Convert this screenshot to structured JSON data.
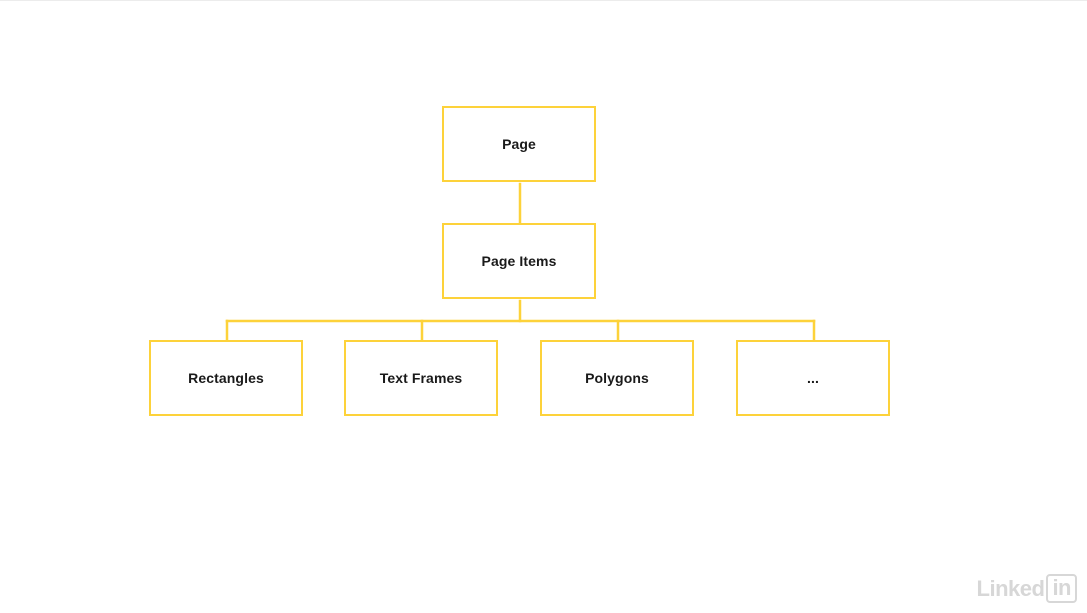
{
  "diagram": {
    "nodes": {
      "page": "Page",
      "page_items": "Page Items",
      "rectangles": "Rectangles",
      "text_frames": "Text Frames",
      "polygons": "Polygons",
      "more": "..."
    },
    "edges": [
      [
        "page",
        "page_items"
      ],
      [
        "page_items",
        "rectangles"
      ],
      [
        "page_items",
        "text_frames"
      ],
      [
        "page_items",
        "polygons"
      ],
      [
        "page_items",
        "more"
      ]
    ],
    "colors": {
      "box_border": "#fdd23a",
      "connector": "#fdd23a",
      "text": "#1a1a1a",
      "background": "#ffffff"
    }
  },
  "watermark": {
    "word": "Linked",
    "boxed": "in",
    "color": "#d7d7d7"
  }
}
